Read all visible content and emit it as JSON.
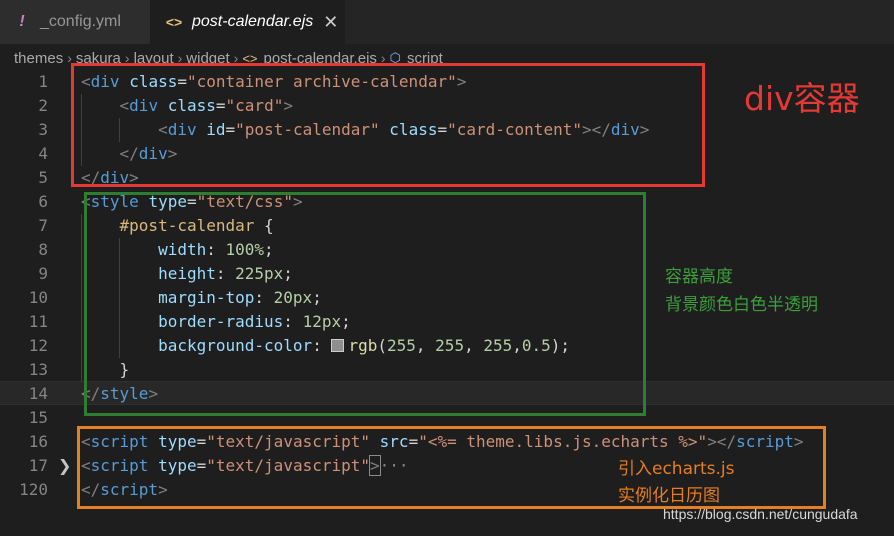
{
  "tabs": [
    {
      "label": "_config.yml",
      "icon": "exclamation-icon",
      "active": false
    },
    {
      "label": "post-calendar.ejs",
      "icon": "angle-brackets-icon",
      "active": true,
      "close": "✕"
    }
  ],
  "breadcrumb": [
    "themes",
    "sakura",
    "layout",
    "widget",
    "post-calendar.ejs",
    "script"
  ],
  "lines": [
    {
      "n": "1",
      "t": [
        [
          "t-punc",
          "<"
        ],
        [
          "t-tag",
          "div"
        ],
        [
          "t-plain",
          " "
        ],
        [
          "t-attr",
          "class"
        ],
        [
          "t-plain",
          "="
        ],
        [
          "t-str",
          "\"container archive-calendar\""
        ],
        [
          "t-punc",
          ">"
        ]
      ]
    },
    {
      "n": "2",
      "t": [
        [
          "t-plain",
          "    "
        ],
        [
          "t-punc",
          "<"
        ],
        [
          "t-tag",
          "div"
        ],
        [
          "t-plain",
          " "
        ],
        [
          "t-attr",
          "class"
        ],
        [
          "t-plain",
          "="
        ],
        [
          "t-str",
          "\"card\""
        ],
        [
          "t-punc",
          ">"
        ]
      ]
    },
    {
      "n": "3",
      "t": [
        [
          "t-plain",
          "        "
        ],
        [
          "t-punc",
          "<"
        ],
        [
          "t-tag",
          "div"
        ],
        [
          "t-plain",
          " "
        ],
        [
          "t-attr",
          "id"
        ],
        [
          "t-plain",
          "="
        ],
        [
          "t-str",
          "\"post-calendar\""
        ],
        [
          "t-plain",
          " "
        ],
        [
          "t-attr",
          "class"
        ],
        [
          "t-plain",
          "="
        ],
        [
          "t-str",
          "\"card-content\""
        ],
        [
          "t-punc",
          "></"
        ],
        [
          "t-tag",
          "div"
        ],
        [
          "t-punc",
          ">"
        ]
      ]
    },
    {
      "n": "4",
      "t": [
        [
          "t-plain",
          "    "
        ],
        [
          "t-punc",
          "</"
        ],
        [
          "t-tag",
          "div"
        ],
        [
          "t-punc",
          ">"
        ]
      ]
    },
    {
      "n": "5",
      "t": [
        [
          "t-punc",
          "</"
        ],
        [
          "t-tag",
          "div"
        ],
        [
          "t-punc",
          ">"
        ]
      ]
    },
    {
      "n": "6",
      "t": [
        [
          "t-punc",
          "<"
        ],
        [
          "t-tag",
          "style"
        ],
        [
          "t-plain",
          " "
        ],
        [
          "t-attr",
          "type"
        ],
        [
          "t-plain",
          "="
        ],
        [
          "t-str",
          "\"text/css\""
        ],
        [
          "t-punc",
          ">"
        ]
      ]
    },
    {
      "n": "7",
      "t": [
        [
          "t-plain",
          "    "
        ],
        [
          "t-sel",
          "#post-calendar"
        ],
        [
          "t-plain",
          " {"
        ]
      ]
    },
    {
      "n": "8",
      "t": [
        [
          "t-plain",
          "        "
        ],
        [
          "t-prop",
          "width"
        ],
        [
          "t-plain",
          ": "
        ],
        [
          "t-num",
          "100%"
        ],
        [
          "t-plain",
          ";"
        ]
      ]
    },
    {
      "n": "9",
      "t": [
        [
          "t-plain",
          "        "
        ],
        [
          "t-prop",
          "height"
        ],
        [
          "t-plain",
          ": "
        ],
        [
          "t-num",
          "225px"
        ],
        [
          "t-plain",
          ";"
        ]
      ]
    },
    {
      "n": "10",
      "t": [
        [
          "t-plain",
          "        "
        ],
        [
          "t-prop",
          "margin-top"
        ],
        [
          "t-plain",
          ": "
        ],
        [
          "t-num",
          "20px"
        ],
        [
          "t-plain",
          ";"
        ]
      ]
    },
    {
      "n": "11",
      "t": [
        [
          "t-plain",
          "        "
        ],
        [
          "t-prop",
          "border-radius"
        ],
        [
          "t-plain",
          ": "
        ],
        [
          "t-num",
          "12px"
        ],
        [
          "t-plain",
          ";"
        ]
      ]
    },
    {
      "n": "12",
      "t": [
        [
          "t-plain",
          "        "
        ],
        [
          "t-prop",
          "background-color"
        ],
        [
          "t-plain",
          ": "
        ],
        [
          "swatch",
          ""
        ],
        [
          "t-fn",
          "rgb"
        ],
        [
          "t-plain",
          "("
        ],
        [
          "t-num",
          "255"
        ],
        [
          "t-plain",
          ", "
        ],
        [
          "t-num",
          "255"
        ],
        [
          "t-plain",
          ", "
        ],
        [
          "t-num",
          "255"
        ],
        [
          "t-plain",
          ","
        ],
        [
          "t-num",
          "0.5"
        ],
        [
          "t-plain",
          ");"
        ]
      ]
    },
    {
      "n": "13",
      "t": [
        [
          "t-plain",
          "    }"
        ]
      ]
    },
    {
      "n": "14",
      "t": [
        [
          "t-punc",
          "</"
        ],
        [
          "t-tag",
          "style"
        ],
        [
          "t-punc",
          ">"
        ]
      ]
    },
    {
      "n": "15",
      "t": []
    },
    {
      "n": "16",
      "t": [
        [
          "t-punc",
          "<"
        ],
        [
          "t-tag",
          "script"
        ],
        [
          "t-plain",
          " "
        ],
        [
          "t-attr",
          "type"
        ],
        [
          "t-plain",
          "="
        ],
        [
          "t-str",
          "\"text/javascript\""
        ],
        [
          "t-plain",
          " "
        ],
        [
          "t-attr",
          "src"
        ],
        [
          "t-plain",
          "="
        ],
        [
          "t-str",
          "\"<%= theme.libs.js.echarts %>\""
        ],
        [
          "t-punc",
          "></"
        ],
        [
          "t-tag",
          "script"
        ],
        [
          "t-punc",
          ">"
        ]
      ]
    },
    {
      "n": "17",
      "fold": "❯",
      "t": [
        [
          "t-punc",
          "<"
        ],
        [
          "t-tag",
          "script"
        ],
        [
          "t-plain",
          " "
        ],
        [
          "t-attr",
          "type"
        ],
        [
          "t-plain",
          "="
        ],
        [
          "t-str",
          "\"text/javascript\""
        ],
        [
          "folded",
          ">"
        ],
        [
          "t-dots",
          "···"
        ]
      ]
    },
    {
      "n": "120",
      "t": [
        [
          "t-punc",
          "</"
        ],
        [
          "t-tag",
          "script"
        ],
        [
          "t-punc",
          ">"
        ]
      ]
    }
  ],
  "annotations": {
    "red": "div容器",
    "green_1": "容器高度",
    "green_2": "背景颜色白色半透明",
    "orange_1": "引入echarts.js",
    "orange_2": "实例化日历图"
  },
  "watermark": "https://blog.csdn.net/cungudafa",
  "colors": {
    "red": "#e53935",
    "green": "#2e7d32",
    "orange": "#e67e22"
  }
}
